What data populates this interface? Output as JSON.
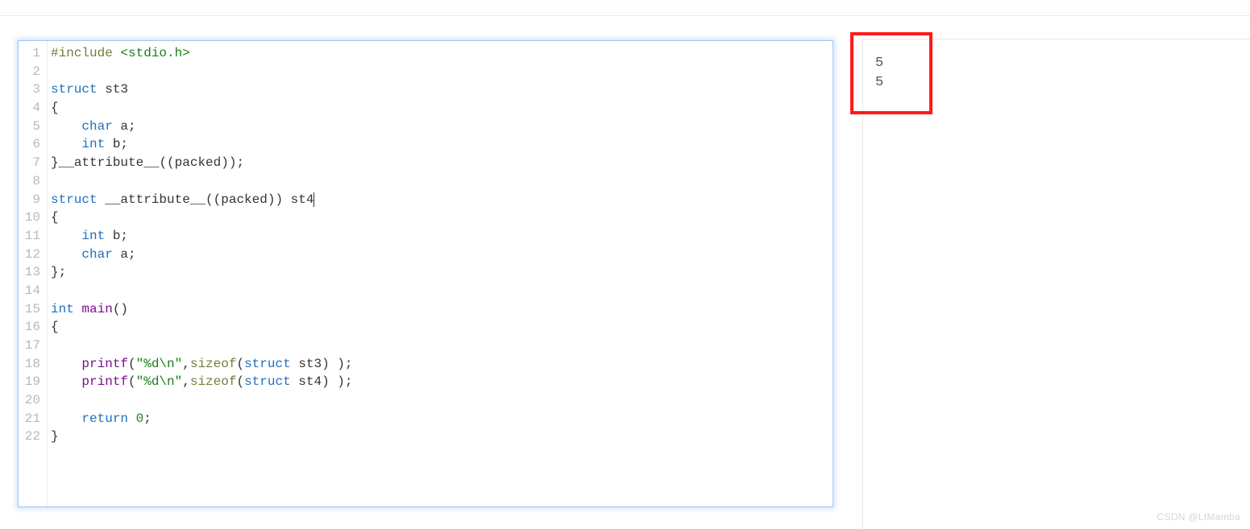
{
  "editor": {
    "line_count": 22,
    "code_lines": [
      [
        {
          "cls": "include-hl",
          "t": "#include "
        },
        {
          "cls": "angle-str",
          "t": "<stdio.h>"
        }
      ],
      [],
      [
        {
          "cls": "kw-struct",
          "t": "struct "
        },
        {
          "cls": "name-td",
          "t": "st3"
        }
      ],
      [
        {
          "cls": "punct",
          "t": "{"
        }
      ],
      [
        {
          "cls": "punct",
          "t": "    "
        },
        {
          "cls": "kw-type",
          "t": "char "
        },
        {
          "cls": "identifier",
          "t": "a"
        },
        {
          "cls": "punct",
          "t": ";"
        }
      ],
      [
        {
          "cls": "punct",
          "t": "    "
        },
        {
          "cls": "kw-type",
          "t": "int "
        },
        {
          "cls": "identifier",
          "t": "b"
        },
        {
          "cls": "punct",
          "t": ";"
        }
      ],
      [
        {
          "cls": "punct",
          "t": "}"
        },
        {
          "cls": "attr",
          "t": "__attribute__"
        },
        {
          "cls": "punct",
          "t": "((packed));"
        }
      ],
      [],
      [
        {
          "cls": "kw-struct",
          "t": "struct "
        },
        {
          "cls": "attr",
          "t": "__attribute__"
        },
        {
          "cls": "punct",
          "t": "((packed)) "
        },
        {
          "cls": "name-td",
          "t": "st4"
        }
      ],
      [
        {
          "cls": "punct",
          "t": "{"
        }
      ],
      [
        {
          "cls": "punct",
          "t": "    "
        },
        {
          "cls": "kw-type",
          "t": "int "
        },
        {
          "cls": "identifier",
          "t": "b"
        },
        {
          "cls": "punct",
          "t": ";"
        }
      ],
      [
        {
          "cls": "punct",
          "t": "    "
        },
        {
          "cls": "kw-type",
          "t": "char "
        },
        {
          "cls": "identifier",
          "t": "a"
        },
        {
          "cls": "punct",
          "t": ";"
        }
      ],
      [
        {
          "cls": "punct",
          "t": "};"
        }
      ],
      [],
      [
        {
          "cls": "kw-type",
          "t": "int "
        },
        {
          "cls": "func",
          "t": "main"
        },
        {
          "cls": "punct",
          "t": "()"
        }
      ],
      [
        {
          "cls": "punct",
          "t": "{"
        }
      ],
      [],
      [
        {
          "cls": "punct",
          "t": "    "
        },
        {
          "cls": "func",
          "t": "printf"
        },
        {
          "cls": "punct",
          "t": "("
        },
        {
          "cls": "string",
          "t": "\"%d\\n\""
        },
        {
          "cls": "punct",
          "t": ","
        },
        {
          "cls": "builtin",
          "t": "sizeof"
        },
        {
          "cls": "punct",
          "t": "("
        },
        {
          "cls": "kw-struct",
          "t": "struct "
        },
        {
          "cls": "name-td",
          "t": "st3"
        },
        {
          "cls": "punct",
          "t": ") );"
        }
      ],
      [
        {
          "cls": "punct",
          "t": "    "
        },
        {
          "cls": "func",
          "t": "printf"
        },
        {
          "cls": "punct",
          "t": "("
        },
        {
          "cls": "string",
          "t": "\"%d\\n\""
        },
        {
          "cls": "punct",
          "t": ","
        },
        {
          "cls": "builtin",
          "t": "sizeof"
        },
        {
          "cls": "punct",
          "t": "("
        },
        {
          "cls": "kw-struct",
          "t": "struct "
        },
        {
          "cls": "name-td",
          "t": "st4"
        },
        {
          "cls": "punct",
          "t": ") );"
        }
      ],
      [],
      [
        {
          "cls": "punct",
          "t": "    "
        },
        {
          "cls": "kw-type",
          "t": "return "
        },
        {
          "cls": "num",
          "t": "0"
        },
        {
          "cls": "punct",
          "t": ";"
        }
      ],
      [
        {
          "cls": "punct",
          "t": "}"
        }
      ]
    ]
  },
  "output": {
    "lines": [
      "5",
      "5"
    ]
  },
  "watermark": "CSDN @LtMamba"
}
